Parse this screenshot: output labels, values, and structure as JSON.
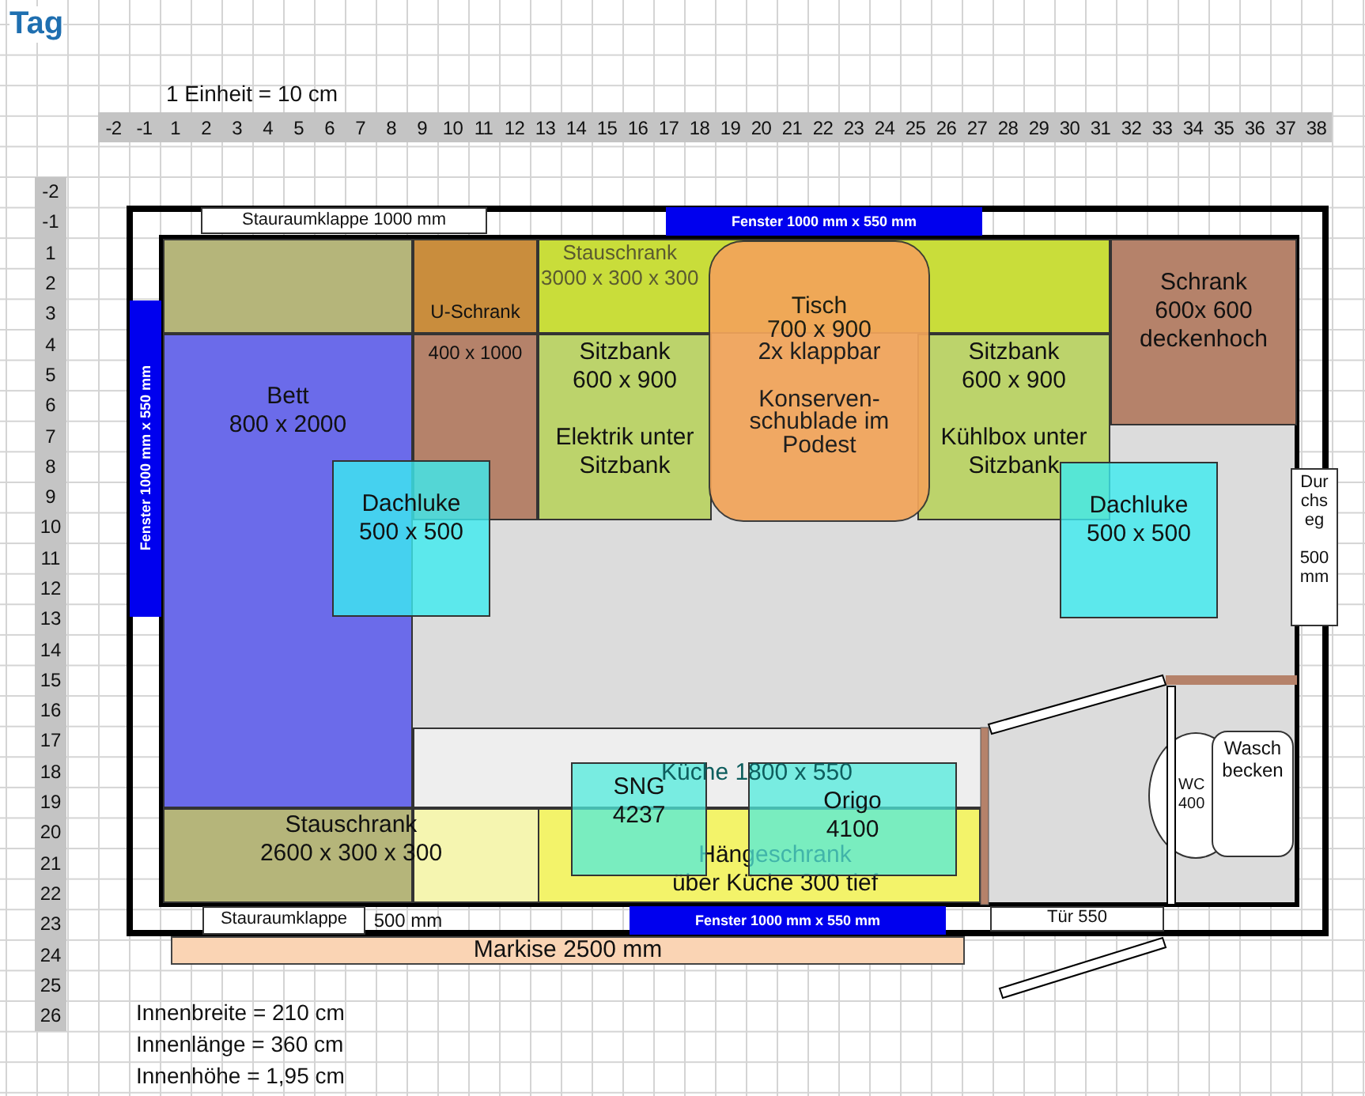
{
  "title": "Tag",
  "scale_note": "1 Einheit = 10 cm",
  "column_headers": [
    "-2",
    "-1",
    "1",
    "2",
    "3",
    "4",
    "5",
    "6",
    "7",
    "8",
    "9",
    "10",
    "11",
    "12",
    "13",
    "14",
    "15",
    "16",
    "17",
    "18",
    "19",
    "20",
    "21",
    "22",
    "23",
    "24",
    "25",
    "26",
    "27",
    "28",
    "29",
    "30",
    "31",
    "32",
    "33",
    "34",
    "35",
    "36",
    "37",
    "38"
  ],
  "row_headers": [
    "-2",
    "-1",
    "1",
    "2",
    "3",
    "4",
    "5",
    "6",
    "7",
    "8",
    "9",
    "10",
    "11",
    "12",
    "13",
    "14",
    "15",
    "16",
    "17",
    "18",
    "19",
    "20",
    "21",
    "22",
    "23",
    "24",
    "25",
    "26"
  ],
  "plan_items": [
    {
      "kind": "zone",
      "color": "#b5b57a"
    },
    {
      "kind": "zone",
      "text": "Bett\n800 x 2000",
      "color": "#6b6bea"
    },
    {
      "kind": "zone",
      "text": "U-Schrank",
      "color": "#c98d3d"
    },
    {
      "kind": "zone",
      "text": "400 x 1000",
      "color": "#b5826a"
    },
    {
      "kind": "zone",
      "text": "Stauschrank\n3000 x 300 x 300",
      "color": "#c9dd3a"
    },
    {
      "kind": "zone",
      "text": "Sitzbank\n600 x 900\n\nElektrik unter\nSitzbank",
      "color": "#bcd36b"
    },
    {
      "kind": "zone",
      "text": "Sitzbank\n600 x 900\n\nKühlbox unter\nSitzbank",
      "color": "#bcd36b"
    },
    {
      "kind": "zone",
      "text": "Schrank\n600x 600\ndeckenhoch",
      "color": "#b5826a"
    },
    {
      "kind": "table",
      "text": "Tisch\n700 x 900\n2x klappbar\n\nKonserven-\nschublade im\nPodest"
    },
    {
      "kind": "zone",
      "color": "#eeeeee"
    },
    {
      "kind": "zone",
      "color": "#b5b57a"
    },
    {
      "kind": "zone",
      "color": "#f5f5b0"
    },
    {
      "kind": "label",
      "text": "Stauschrank\n2600 x 300 x 300"
    },
    {
      "kind": "label",
      "text": "Küche 1800 x 550"
    },
    {
      "kind": "zone",
      "text": "Hängeschrank\nüber Küche 300 tief",
      "color": "#f3f36a"
    },
    {
      "kind": "appliance",
      "text": "SNG\n4237"
    },
    {
      "kind": "appliance",
      "text": "Origo\n4100"
    },
    {
      "kind": "skylight",
      "text": "Dachluke\n500 x 500"
    },
    {
      "kind": "skylight",
      "text": "Dachluke\n500 x 500"
    },
    {
      "kind": "flap",
      "text": "Dur\nchs\neg\n\n500\nmm"
    },
    {
      "kind": "toilet",
      "text": "WC\n400"
    },
    {
      "kind": "sink",
      "text": "Wasch\nbecken"
    },
    {
      "kind": "flap",
      "text": "Stauraumklappe 1000 mm"
    },
    {
      "kind": "window",
      "text": "Fenster 1000 mm x 550 mm"
    },
    {
      "kind": "window_vertical",
      "text": "Fenster 1000 mm x 550 mm"
    },
    {
      "kind": "flap",
      "text": "Stauraumklappe"
    },
    {
      "kind": "label",
      "text": "500 mm"
    },
    {
      "kind": "window",
      "text": "Fenster 1000 mm x 550 mm"
    },
    {
      "kind": "flap",
      "text": "Tür  550"
    },
    {
      "kind": "zone",
      "text": "Markise 2500 mm",
      "color": "#fad4b4"
    }
  ],
  "notes": [
    "Innenbreite = 210 cm",
    "Innenlänge = 360 cm",
    "Innenhöhe = 1,95 cm"
  ]
}
